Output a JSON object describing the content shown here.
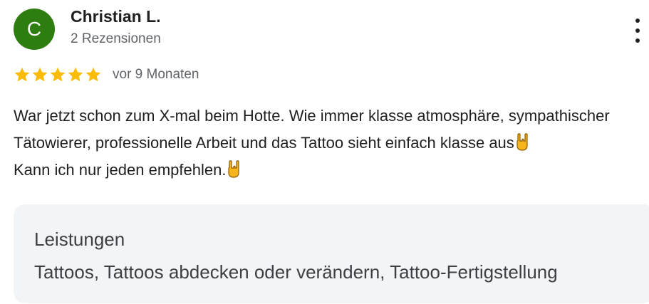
{
  "author": {
    "initial": "C",
    "name": "Christian L.",
    "review_count": "2 Rezensionen",
    "avatar_color": "#2e7d10"
  },
  "more_icon": "more-vertical-icon",
  "rating": {
    "stars": 5,
    "max_stars": 5,
    "star_color": "#fbbc04",
    "date": "vor 9 Monaten"
  },
  "review": {
    "text_line1": "War jetzt schon zum X-mal beim Hotte. Wie immer klasse atmosphäre, sympathischer Tätowierer, professionelle Arbeit und das Tattoo sieht einfach klasse aus",
    "text_line2": "Kann ich nur jeden empfehlen.",
    "emoji": "sign-of-the-horns-emoji"
  },
  "services": {
    "title": "Leistungen",
    "list": "Tattoos, Tattoos abdecken oder verändern, Tattoo-Fertigstellung",
    "box_color": "#f2f5f7"
  }
}
